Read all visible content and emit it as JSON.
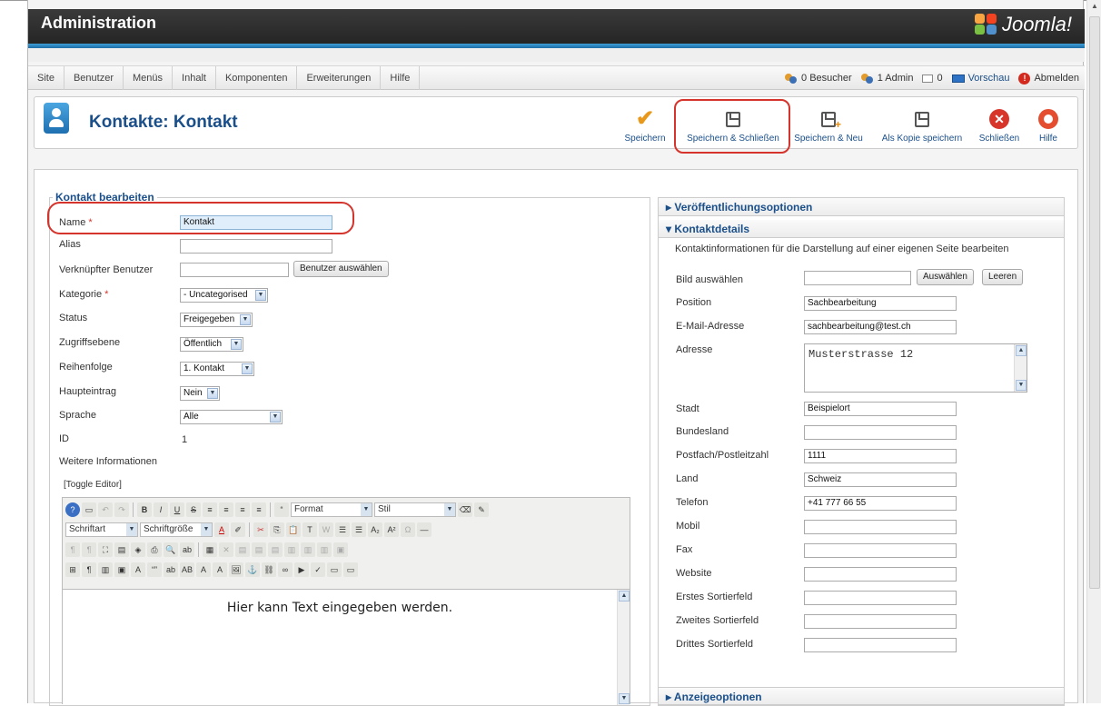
{
  "header": {
    "title": "Administration",
    "logo_text": "Joomla!"
  },
  "menu": [
    "Site",
    "Benutzer",
    "Menüs",
    "Inhalt",
    "Komponenten",
    "Erweiterungen",
    "Hilfe"
  ],
  "status": {
    "visitors": "0 Besucher",
    "admins": "1 Admin",
    "messages": "0",
    "preview": "Vorschau",
    "logout": "Abmelden"
  },
  "page_title": "Kontakte: Kontakt",
  "toolbar": {
    "save": "Speichern",
    "save_close": "Speichern & Schließen",
    "save_new": "Speichern & Neu",
    "save_copy": "Als Kopie speichern",
    "close": "Schließen",
    "help": "Hilfe"
  },
  "form": {
    "legend": "Kontakt bearbeiten",
    "name_label": "Name",
    "required_mark": "*",
    "name_value": "Kontakt",
    "alias_label": "Alias",
    "alias_value": "",
    "linked_user_label": "Verknüpfter Benutzer",
    "select_user_button": "Benutzer auswählen",
    "category_label": "Kategorie",
    "category_value": "- Uncategorised",
    "status_label": "Status",
    "status_value": "Freigegeben",
    "access_label": "Zugriffsebene",
    "access_value": "Öffentlich",
    "order_label": "Reihenfolge",
    "order_value": "1. Kontakt",
    "featured_label": "Haupteintrag",
    "featured_value": "Nein",
    "language_label": "Sprache",
    "language_value": "Alle",
    "id_label": "ID",
    "id_value": "1",
    "more_info_label": "Weitere Informationen",
    "toggle_editor": "[Toggle Editor]"
  },
  "editor": {
    "format": "Format",
    "style": "Stil",
    "font": "Schriftart",
    "font_size": "Schriftgröße",
    "content": "Hier kann Text eingegeben werden."
  },
  "right": {
    "publishing": "Veröffentlichungsoptionen",
    "details": "Kontaktdetails",
    "details_desc": "Kontaktinformationen für die Darstellung auf einer eigenen Seite bearbeiten",
    "image_label": "Bild auswählen",
    "choose_button": "Auswählen",
    "clear_button": "Leeren",
    "position_label": "Position",
    "position_value": "Sachbearbeitung",
    "email_label": "E-Mail-Adresse",
    "email_value": "sachbearbeitung@test.ch",
    "address_label": "Adresse",
    "address_value": "Musterstrasse 12",
    "city_label": "Stadt",
    "city_value": "Beispielort",
    "state_label": "Bundesland",
    "state_value": "",
    "postcode_label": "Postfach/Postleitzahl",
    "postcode_value": "1111",
    "country_label": "Land",
    "country_value": "Schweiz",
    "phone_label": "Telefon",
    "phone_value": "+41 777 66 55",
    "mobile_label": "Mobil",
    "fax_label": "Fax",
    "website_label": "Website",
    "sort1_label": "Erstes Sortierfeld",
    "sort2_label": "Zweites Sortierfeld",
    "sort3_label": "Drittes Sortierfeld",
    "display_options": "Anzeigeoptionen"
  },
  "colors": {
    "accent": "#1a4f8a",
    "highlight": "#d4342c"
  }
}
